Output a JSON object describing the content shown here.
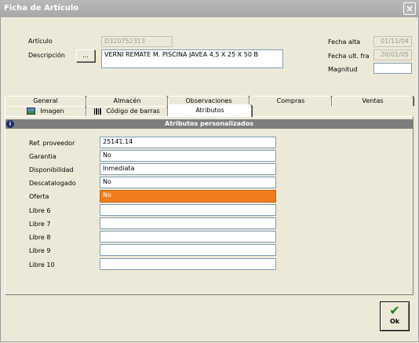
{
  "window": {
    "title": "Ficha de Artículo",
    "close_symbol": "×"
  },
  "header": {
    "articulo_label": "Artículo",
    "articulo_value": "D320752313",
    "descripcion_label": "Descripción",
    "descripcion_button": "...",
    "descripcion_value": "VERNI REMATE M. PISCINA JAVEA 4,5 X 25 X 50 B",
    "fecha_alta_label": "Fecha alta",
    "fecha_alta_value": "01/11/04",
    "fecha_ult_label": "Fecha ult. fra",
    "fecha_ult_value": "20/01/05",
    "magnitud_label": "Magnitud",
    "magnitud_value": ""
  },
  "tabs_row1": [
    {
      "label": "General"
    },
    {
      "label": "Almacén"
    },
    {
      "label": "Observaciones"
    },
    {
      "label": "Compras"
    },
    {
      "label": "Ventas"
    }
  ],
  "tabs_row2": [
    {
      "label": "Imagen"
    },
    {
      "label": "Código de barras"
    },
    {
      "label": "Atributos"
    }
  ],
  "section_title": "Atributos personalizados",
  "attributes": [
    {
      "label": "Ref. proveedor",
      "value": "25141.14"
    },
    {
      "label": "Garantia",
      "value": "No"
    },
    {
      "label": "Disponibilidad",
      "value": "Inmediata"
    },
    {
      "label": "Descatalogado",
      "value": "No"
    },
    {
      "label": "Oferta",
      "value": "No"
    },
    {
      "label": "Libre 6",
      "value": ""
    },
    {
      "label": "Libre 7",
      "value": ""
    },
    {
      "label": "Libre 8",
      "value": ""
    },
    {
      "label": "Libre 9",
      "value": ""
    },
    {
      "label": "Libre 10",
      "value": ""
    }
  ],
  "highlight_color": "#f07c1e",
  "ok_button": {
    "label": "Ok"
  },
  "icons": {
    "ok": "check-icon",
    "info": "info-icon",
    "image": "image-icon",
    "barcode": "barcode-icon"
  }
}
